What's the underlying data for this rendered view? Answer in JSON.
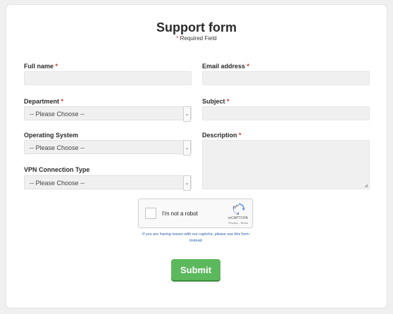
{
  "form": {
    "title": "Support form",
    "required_marker": "*",
    "required_note": "Required Field"
  },
  "fields": {
    "full_name": {
      "label": "Full name",
      "value": ""
    },
    "email": {
      "label": "Email address",
      "value": ""
    },
    "department": {
      "label": "Department",
      "selected": "-- Please Choose --"
    },
    "subject": {
      "label": "Subject",
      "value": ""
    },
    "os": {
      "label": "Operating System",
      "selected": "-- Please Choose --"
    },
    "description": {
      "label": "Description",
      "value": ""
    },
    "vpn": {
      "label": "VPN Connection Type",
      "selected": "-- Please Choose --"
    }
  },
  "captcha": {
    "checkbox_label": "I'm not a robot",
    "brand": "reCAPTCHA",
    "terms": "Privacy - Terms",
    "help_text": "If you are having issues with our captcha, please use this form instead"
  },
  "submit": {
    "label": "Submit"
  },
  "colors": {
    "required": "#e03030",
    "submit": "#5cb85c",
    "link": "#2a5db0"
  },
  "icons": {
    "select_arrow": "chevron-down-icon",
    "captcha_logo": "recaptcha-logo-icon"
  }
}
